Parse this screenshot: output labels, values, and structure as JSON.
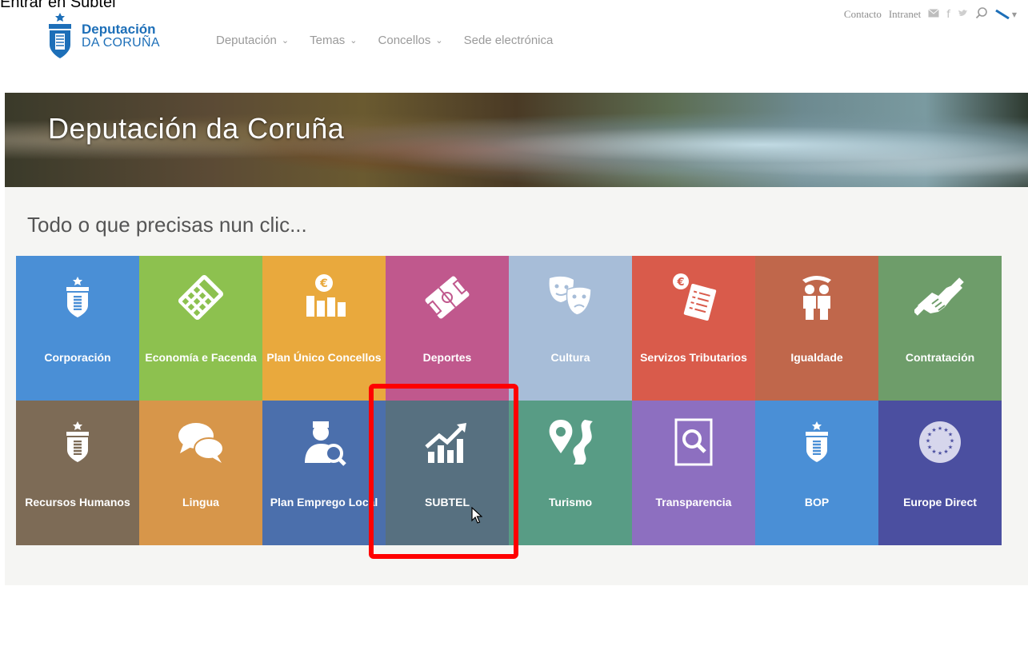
{
  "caption": "Entrar en Subtel",
  "header": {
    "logo_line1": "Deputación",
    "logo_line2": "DA CORUÑA",
    "nav": [
      {
        "label": "Deputación",
        "has_dropdown": true
      },
      {
        "label": "Temas",
        "has_dropdown": true
      },
      {
        "label": "Concellos",
        "has_dropdown": true
      },
      {
        "label": "Sede electrónica",
        "has_dropdown": false
      }
    ],
    "top_links": [
      "Contacto",
      "Intranet"
    ],
    "top_icons": [
      "mail-icon",
      "facebook-icon",
      "twitter-icon",
      "search-icon",
      "language-icon"
    ],
    "accent_color": "#1d6fb8"
  },
  "banner": {
    "title": "Deputación da Coruña"
  },
  "main": {
    "subtitle": "Todo o que precisas nun clic...",
    "tiles": [
      {
        "label": "Corporación",
        "color": "#4a8fd6",
        "icon": "crest-icon"
      },
      {
        "label": "Economía e Facenda",
        "color": "#8dc14f",
        "icon": "calculator-icon"
      },
      {
        "label": "Plan Único Concellos",
        "color": "#e9a93d",
        "icon": "euro-chart-icon"
      },
      {
        "label": "Deportes",
        "color": "#c0588d",
        "icon": "football-field-icon"
      },
      {
        "label": "Cultura",
        "color": "#a7bdd8",
        "icon": "theater-masks-icon"
      },
      {
        "label": "Servizos Tributarios",
        "color": "#d95b4b",
        "icon": "tax-document-icon"
      },
      {
        "label": "Igualdade",
        "color": "#c0674b",
        "icon": "people-icon"
      },
      {
        "label": "Contratación",
        "color": "#6e9d6a",
        "icon": "handshake-icon"
      },
      {
        "label": "Recursos Humanos",
        "color": "#7d6b56",
        "icon": "crest-icon"
      },
      {
        "label": "Lingua",
        "color": "#d7964a",
        "icon": "speech-bubbles-icon"
      },
      {
        "label": "Plan Emprego Local",
        "color": "#4b6fac",
        "icon": "person-search-icon"
      },
      {
        "label": "SUBTEL",
        "color": "#577080",
        "icon": "growth-chart-icon"
      },
      {
        "label": "Turismo",
        "color": "#589c85",
        "icon": "map-pin-road-icon"
      },
      {
        "label": "Transparencia",
        "color": "#8d6fc0",
        "icon": "magnifier-doc-icon"
      },
      {
        "label": "BOP",
        "color": "#4a8fd6",
        "icon": "crest-icon"
      },
      {
        "label": "Europe Direct",
        "color": "#4b4fa0",
        "icon": "eu-stars-icon"
      }
    ]
  }
}
